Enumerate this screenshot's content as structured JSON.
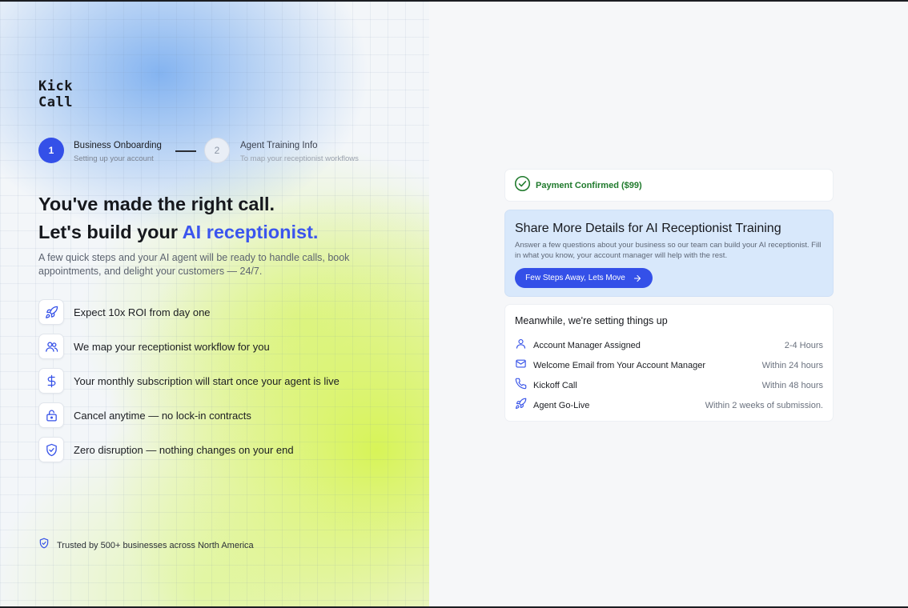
{
  "brand": {
    "logo_line1": "Kick",
    "logo_line2": "Call"
  },
  "stepper": {
    "steps": [
      {
        "number": "1",
        "title": "Business Onboarding",
        "subtitle": "Setting up your account"
      },
      {
        "number": "2",
        "title": "Agent Training Info",
        "subtitle": "To map your receptionist workflows"
      }
    ]
  },
  "hero": {
    "line1": "You've made the right call.",
    "line2_prefix": "Let's build your ",
    "line2_accent": "AI receptionist.",
    "subcopy": "A few quick steps and your AI agent will be ready to handle calls, book appointments, and delight your customers — 24/7."
  },
  "features": [
    {
      "icon": "rocket-icon",
      "label": "Expect 10x ROI from day one"
    },
    {
      "icon": "users-icon",
      "label": "We map your receptionist workflow for you"
    },
    {
      "icon": "dollar-icon",
      "label": "Your monthly subscription will start once your agent is live"
    },
    {
      "icon": "unlock-icon",
      "label": "Cancel anytime — no lock-in contracts"
    },
    {
      "icon": "shield-check-icon",
      "label": "Zero disruption — nothing changes on your end"
    }
  ],
  "trust": {
    "icon": "shield-check-icon",
    "label": "Trusted by 500+ businesses across North America"
  },
  "payment": {
    "icon": "check-circle-icon",
    "label": "Payment Confirmed ($99)"
  },
  "share": {
    "title": "Share More Details for AI Receptionist Training",
    "description": "Answer a few questions about your business so our team can build your AI receptionist. Fill in what you know, your account manager will help with the rest.",
    "button_label": "Few Steps Away, Lets Move"
  },
  "setup": {
    "title": "Meanwhile, we're setting things up",
    "items": [
      {
        "icon": "user-icon",
        "label": "Account Manager Assigned",
        "time": "2-4 Hours"
      },
      {
        "icon": "mail-icon",
        "label": "Welcome Email from Your Account Manager",
        "time": "Within 24 hours"
      },
      {
        "icon": "phone-icon",
        "label": "Kickoff Call",
        "time": "Within 48 hours"
      },
      {
        "icon": "rocket-icon",
        "label": "Agent Go-Live",
        "time": "Within 2 weeks of submission."
      }
    ]
  },
  "colors": {
    "accent": "#3b55ee",
    "success": "#1f7a2c",
    "share_card_bg": "#d8e8fb"
  }
}
